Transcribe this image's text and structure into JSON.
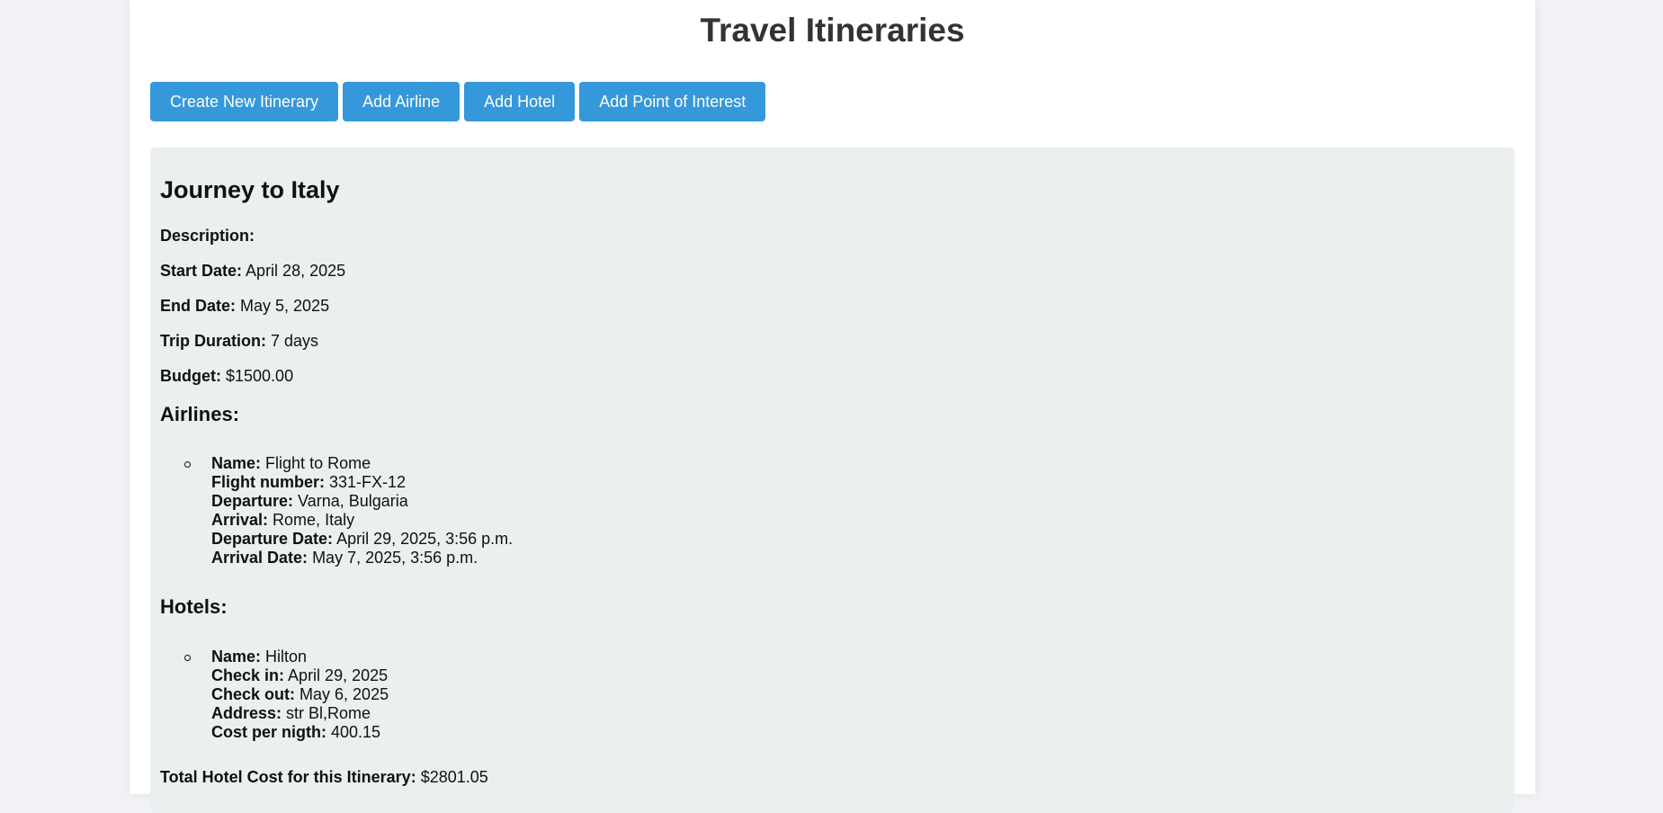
{
  "page": {
    "title": "Travel Itineraries"
  },
  "actions": {
    "create_itinerary": "Create New Itinerary",
    "add_airline": "Add Airline",
    "add_hotel": "Add Hotel",
    "add_poi": "Add Point of Interest"
  },
  "itinerary": {
    "title": "Journey to Italy",
    "description_label": "Description:",
    "description_value": "",
    "start_date_label": "Start Date:",
    "start_date_value": "April 28, 2025",
    "end_date_label": "End Date:",
    "end_date_value": "May 5, 2025",
    "duration_label": "Trip Duration:",
    "duration_value": "7 days",
    "budget_label": "Budget:",
    "budget_value": "$1500.00",
    "airlines_heading": "Airlines:",
    "airlines": [
      {
        "name_label": "Name:",
        "name": "Flight to Rome",
        "flight_number_label": "Flight number:",
        "flight_number": "331-FX-12",
        "departure_label": "Departure:",
        "departure": "Varna, Bulgaria",
        "arrival_label": "Arrival:",
        "arrival": "Rome, Italy",
        "departure_date_label": "Departure Date:",
        "departure_date": "April 29, 2025, 3:56 p.m.",
        "arrival_date_label": "Arrival Date:",
        "arrival_date": "May 7, 2025, 3:56 p.m."
      }
    ],
    "hotels_heading": "Hotels:",
    "hotels": [
      {
        "name_label": "Name:",
        "name": "Hilton",
        "check_in_label": "Check in:",
        "check_in": "April 29, 2025",
        "check_out_label": "Check out:",
        "check_out": "May 6, 2025",
        "address_label": "Address:",
        "address": "str Bl,Rome",
        "cost_label": "Cost per nigth:",
        "cost": "400.15"
      }
    ],
    "total_hotel_cost_label": "Total Hotel Cost for this Itinerary:",
    "total_hotel_cost_value": "$2801.05"
  },
  "colors": {
    "accent": "#3498db",
    "card_bg": "#ebeff0",
    "page_bg": "#f1f2f5",
    "title": "#333333"
  }
}
